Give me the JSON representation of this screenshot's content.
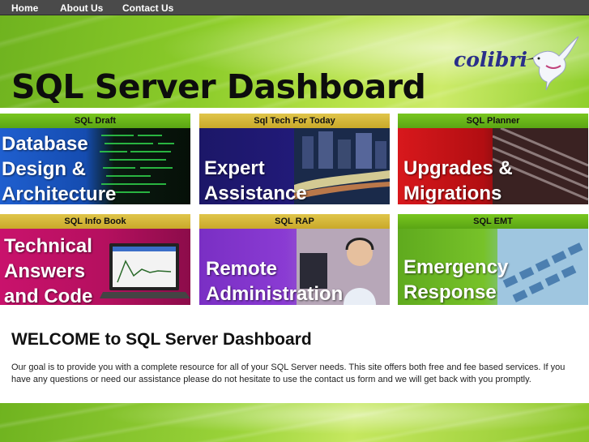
{
  "nav": {
    "items": [
      {
        "label": "Home"
      },
      {
        "label": "About Us"
      },
      {
        "label": "Contact Us"
      }
    ]
  },
  "header": {
    "site_title": "SQL Server Dashboard",
    "logo_text": "colibri",
    "logo_icon": "hummingbird-icon"
  },
  "tiles": [
    {
      "bar": "SQL Draft",
      "lines": [
        "Database",
        "Design &",
        "Architecture"
      ],
      "accent": "#79c61f"
    },
    {
      "bar": "Sql Tech For Today",
      "lines": [
        "Expert",
        "Assistance"
      ],
      "accent": "#e0c54a"
    },
    {
      "bar": "SQL Planner",
      "lines": [
        "Upgrades &",
        "Migrations"
      ],
      "accent": "#79c61f"
    },
    {
      "bar": "SQL Info Book",
      "lines": [
        "Technical",
        "Answers",
        "and Code"
      ],
      "accent": "#e0c54a"
    },
    {
      "bar": "SQL RAP",
      "lines": [
        "Remote",
        "Administration"
      ],
      "accent": "#e0c54a"
    },
    {
      "bar": "SQL EMT",
      "lines": [
        "Emergency",
        "Response"
      ],
      "accent": "#79c61f"
    }
  ],
  "welcome": {
    "title": "WELCOME to SQL Server Dashboard",
    "text": "Our goal is to provide you with a complete resource for all of your SQL Server needs. This site offers both free and fee based services. If you have any questions or need our assistance please do not hesitate to use the contact us form and we will get back with you promptly."
  },
  "colors": {
    "nav_bg": "#4a4a4a",
    "brand_green": "#79c61f",
    "brand_gold": "#e0c54a"
  }
}
